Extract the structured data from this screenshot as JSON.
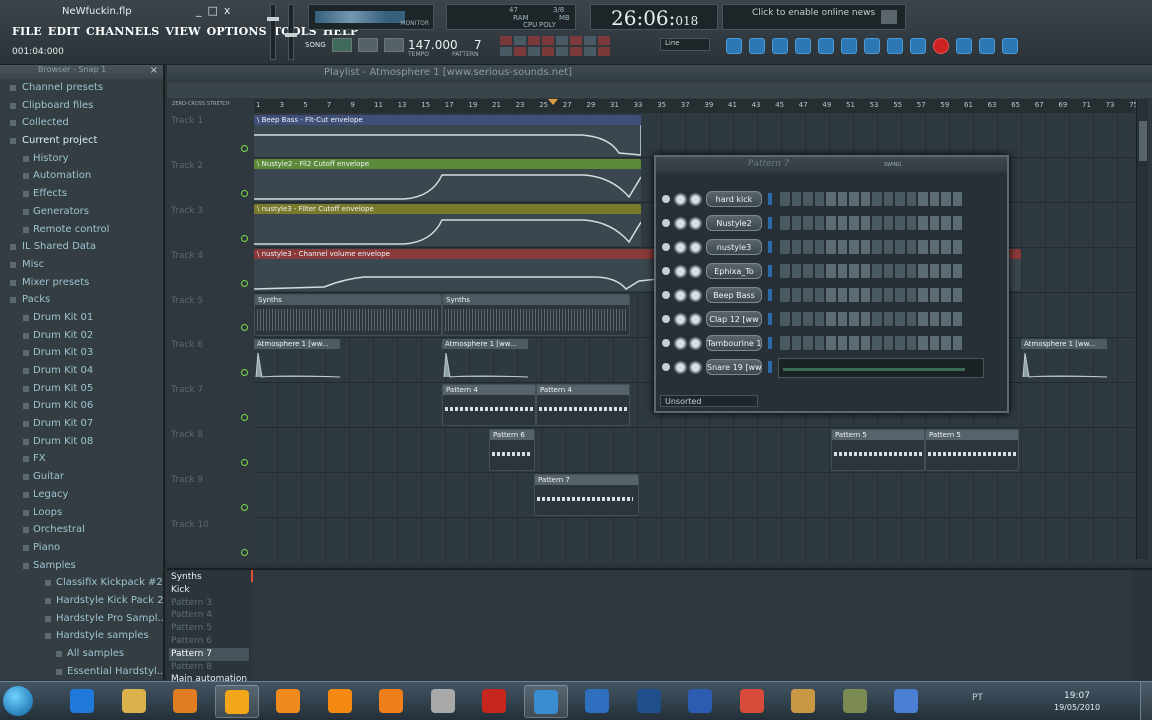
{
  "window": {
    "title": "NeWfuckin.flp",
    "min": "_",
    "max": "□",
    "close": "x"
  },
  "menu": [
    "FILE",
    "EDIT",
    "CHANNELS",
    "VIEW",
    "OPTIONS",
    "TOOLS",
    "HELP"
  ],
  "time_signature": "001:04:000",
  "monitor_label": "MONITOR",
  "cpu": {
    "ram_value": "47",
    "ram_label": "RAM",
    "cpu_value": "3/8",
    "cpu_label": "CPU",
    "poly_label": "POLY",
    "mb_label": "MB"
  },
  "clock": {
    "main": "26:06:",
    "sub": "018"
  },
  "online_hint": "Click to enable online news",
  "transport": {
    "song_label": "SONG",
    "tempo": "147.000",
    "tempo_label": "TEMPO",
    "pattern": "7",
    "pattern_label": "PATTERN"
  },
  "snap_select": "Line",
  "browser": {
    "title": "Browser - Snap 1",
    "close": "×",
    "items": [
      {
        "label": "Channel presets",
        "level": 0
      },
      {
        "label": "Clipboard files",
        "level": 0
      },
      {
        "label": "Collected",
        "level": 0
      },
      {
        "label": "Current project",
        "level": 0
      },
      {
        "label": "History",
        "level": 1
      },
      {
        "label": "Automation",
        "level": 1
      },
      {
        "label": "Effects",
        "level": 1
      },
      {
        "label": "Generators",
        "level": 1
      },
      {
        "label": "Remote control",
        "level": 1
      },
      {
        "label": "IL Shared Data",
        "level": 0
      },
      {
        "label": "Misc",
        "level": 0
      },
      {
        "label": "Mixer presets",
        "level": 0
      },
      {
        "label": "Packs",
        "level": 0
      },
      {
        "label": "Drum Kit 01",
        "level": 1
      },
      {
        "label": "Drum Kit 02",
        "level": 1
      },
      {
        "label": "Drum Kit 03",
        "level": 1
      },
      {
        "label": "Drum Kit 04",
        "level": 1
      },
      {
        "label": "Drum Kit 05",
        "level": 1
      },
      {
        "label": "Drum Kit 06",
        "level": 1
      },
      {
        "label": "Drum Kit 07",
        "level": 1
      },
      {
        "label": "Drum Kit 08",
        "level": 1
      },
      {
        "label": "FX",
        "level": 1
      },
      {
        "label": "Guitar",
        "level": 1
      },
      {
        "label": "Legacy",
        "level": 1
      },
      {
        "label": "Loops",
        "level": 1
      },
      {
        "label": "Orchestral",
        "level": 1
      },
      {
        "label": "Piano",
        "level": 1
      },
      {
        "label": "Samples",
        "level": 1
      },
      {
        "label": "Classifix Kickpack #2",
        "level": 2
      },
      {
        "label": "Hardstyle Kick Pack 2",
        "level": 2
      },
      {
        "label": "Hardstyle Pro Sampl...",
        "level": 2
      },
      {
        "label": "Hardstyle samples",
        "level": 2
      },
      {
        "label": "All samples",
        "level": 3
      },
      {
        "label": "Essential Hardstyl...",
        "level": 3
      }
    ]
  },
  "playlist": {
    "title": "Playlist - Atmosphere 1 [www.serious-sounds.net]",
    "zero_cross": "ZERO-CROSS",
    "stretch": "STRETCH",
    "bars": [
      "1",
      "3",
      "5",
      "7",
      "9",
      "11",
      "13",
      "15",
      "17",
      "19",
      "21",
      "23",
      "25",
      "27",
      "29",
      "31",
      "33",
      "35",
      "37",
      "39",
      "41",
      "43",
      "45",
      "47",
      "49",
      "51",
      "53",
      "55",
      "57",
      "59",
      "61",
      "63",
      "65",
      "67",
      "69",
      "71",
      "73",
      "75"
    ],
    "tracks": [
      "Track 1",
      "Track 2",
      "Track 3",
      "Track 4",
      "Track 5",
      "Track 6",
      "Track 7",
      "Track 8",
      "Track 9",
      "Track 10"
    ],
    "clips": {
      "c1": "\\ Beep Bass - Flt-Cut envelope",
      "c2": "\\ Nustyle2 - Fil2 Cutoff envelope",
      "c3": "\\ nustyle3 - Filter Cutoff envelope",
      "c4": "\\ nustyle3 - Channel volume envelope",
      "c5a": "Synths",
      "c5b": "Synths",
      "c6a": "Atmosphere 1 [ww...",
      "c6b": "Atmosphere 1 [ww...",
      "c6c": "Atmosphere 1 [ww...",
      "c7a": "Pattern 4",
      "c7b": "Pattern 4",
      "c8a": "Pattern 6",
      "c8b": "Pattern 5",
      "c8c": "Pattern 5",
      "c9a": "Pattern 7"
    },
    "colors": {
      "c1": "#3f4f7a",
      "c2": "#5d8a3a",
      "c3": "#7a7a2c",
      "c4": "#8a3a3a"
    }
  },
  "rack": {
    "title": "Pattern 7",
    "swing": "SWING",
    "channels": [
      "hard kick",
      "Nustyle2",
      "nustyle3",
      "Ephixa_To",
      "Beep Bass",
      "Clap 12 [ww",
      "Tambourine 1",
      "Snare 19 [ww"
    ],
    "footer": "Unsorted"
  },
  "patterns": [
    {
      "label": "Synths",
      "state": "bright"
    },
    {
      "label": "Kick",
      "state": "bright"
    },
    {
      "label": "Pattern 3",
      "state": "dim"
    },
    {
      "label": "Pattern 4",
      "state": "dim"
    },
    {
      "label": "Pattern 5",
      "state": "dim"
    },
    {
      "label": "Pattern 6",
      "state": "dim"
    },
    {
      "label": "Pattern 7",
      "state": "selected"
    },
    {
      "label": "Pattern 8",
      "state": "dim"
    },
    {
      "label": "Main automation",
      "state": "bright"
    }
  ],
  "taskbar": {
    "apps": [
      "internet-explorer-icon",
      "folder-icon",
      "media-player-icon",
      "fl-studio-icon",
      "windows-live-icon",
      "winamp-icon",
      "vlc-icon",
      "tools-icon",
      "adobe-reader-icon",
      "messenger-icon",
      "thunderbird-icon",
      "photoshop-icon",
      "firefox-icon",
      "anchor-icon",
      "paint-icon",
      "plant-icon",
      "safari-icon"
    ],
    "app_colors": [
      "#1f79d8",
      "#d9b24c",
      "#e07c22",
      "#f2a71b",
      "#f08a1e",
      "#f58a12",
      "#ef7f1a",
      "#a8a8a8",
      "#c7261f",
      "#3a8cd0",
      "#2f6fc0",
      "#1e4f8a",
      "#2b5caf",
      "#d84a3a",
      "#c89844",
      "#7a8a52",
      "#4a7fd4"
    ],
    "tray_lang": "PT",
    "tray_time": "19:07",
    "tray_date": "19/05/2010"
  }
}
